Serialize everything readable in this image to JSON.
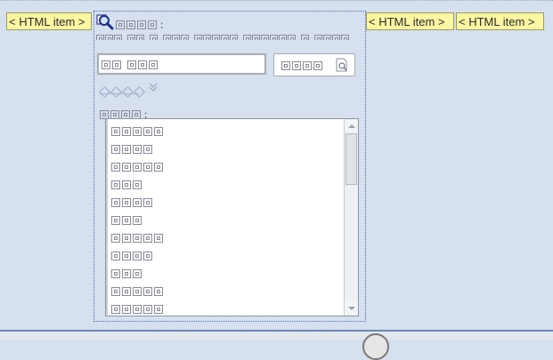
{
  "html_items": [
    "< HTML item >",
    "< HTML item >",
    "< HTML item >"
  ],
  "panel": {
    "title": "□□□□:",
    "subtitle": "□□□ □□ □ □□□ □□□□□ □□□□□□ □ □□□□",
    "search": {
      "value": "□□ □□□",
      "button_label": "□□□□"
    },
    "advanced_label": "◇◇◇◇",
    "list_label": "□□□□:",
    "list_items": [
      "□□□□□",
      "□□□□",
      "□□□□□",
      "□□□",
      "□□□□",
      "□□□",
      "□□□□□",
      "□□□□",
      "□□□",
      "□□□□□",
      "□□□□□"
    ]
  },
  "icons": {
    "title": "search-magnifier-icon",
    "search_button": "document-search-icon",
    "advanced_toggle": "chevron-down-icon"
  },
  "colors": {
    "background": "#d6e0ee",
    "html_item": "#fbf6a2",
    "accent": "#4a6fa8"
  }
}
